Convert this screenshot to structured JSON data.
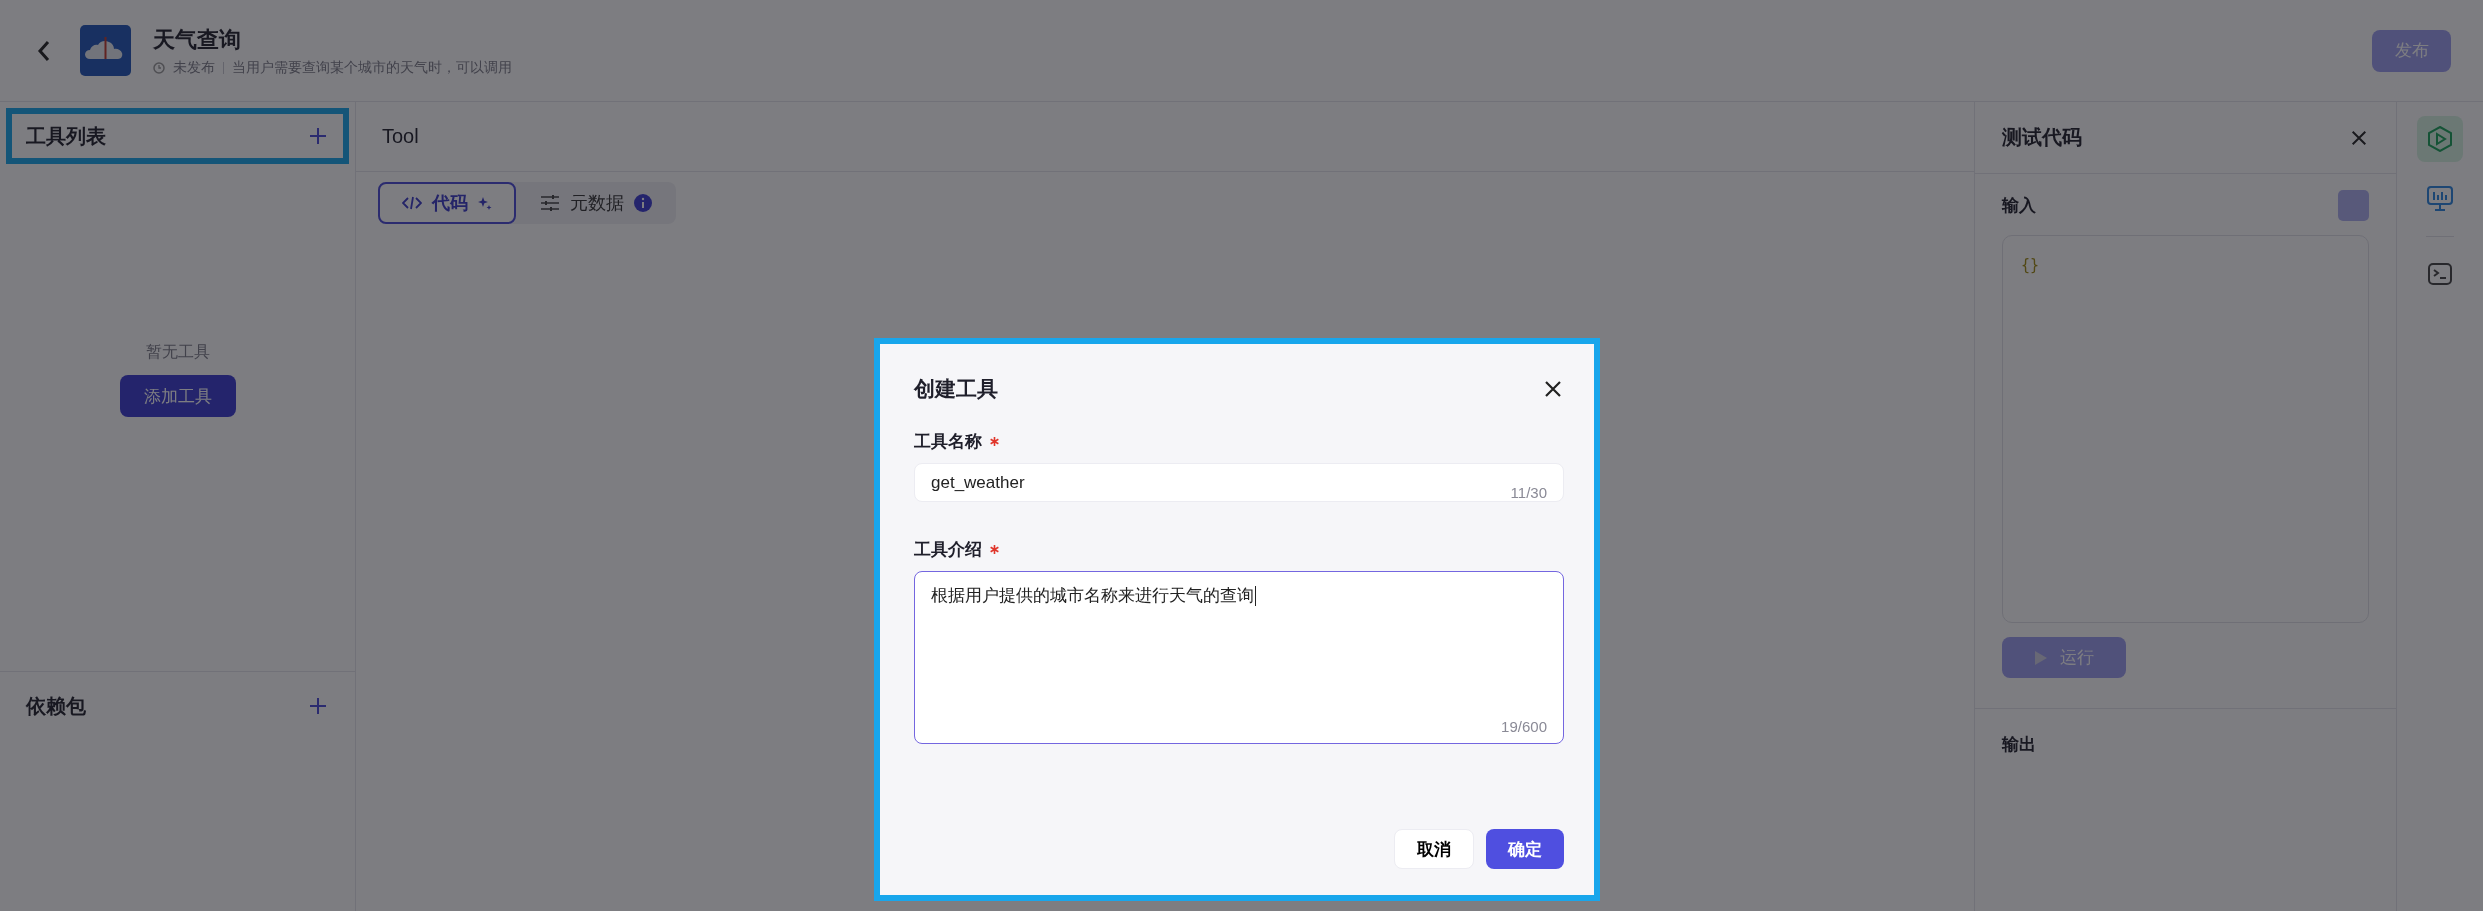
{
  "header": {
    "title": "天气查询",
    "status": "未发布",
    "description": "当用户需要查询某个城市的天气时，可以调用",
    "publish_button": {
      "label": "发布",
      "disabled": true
    }
  },
  "sidebar": {
    "tool_list": {
      "title": "工具列表",
      "highlighted": true,
      "empty_text": "暂无工具",
      "add_button": "添加工具"
    },
    "dependencies": {
      "title": "依赖包"
    }
  },
  "editor": {
    "title": "Tool",
    "tabs": [
      {
        "label": "代码",
        "selected": true,
        "kind": "code"
      },
      {
        "label": "元数据",
        "selected": false,
        "kind": "meta"
      }
    ]
  },
  "test_panel": {
    "title": "测试代码",
    "input_label": "输入",
    "input_code": "{}",
    "run_button": {
      "label": "运行",
      "disabled": true
    },
    "output_label": "输出"
  },
  "rail": [
    {
      "kind": "run",
      "selected": true
    },
    {
      "kind": "monitor",
      "selected": false
    },
    {
      "kind": "terminal",
      "selected": false
    }
  ],
  "dialog": {
    "title": "创建工具",
    "highlighted": true,
    "fields": [
      {
        "label": "工具名称",
        "required": true,
        "kind": "input",
        "value": "get_weather",
        "counter": "11/30",
        "focused": false
      },
      {
        "label": "工具介绍",
        "required": true,
        "kind": "textarea",
        "value": "根据用户提供的城市名称来进行天气的查询",
        "counter": "19/600",
        "focused": true
      }
    ],
    "cancel_button": "取消",
    "confirm_button": "确定"
  }
}
